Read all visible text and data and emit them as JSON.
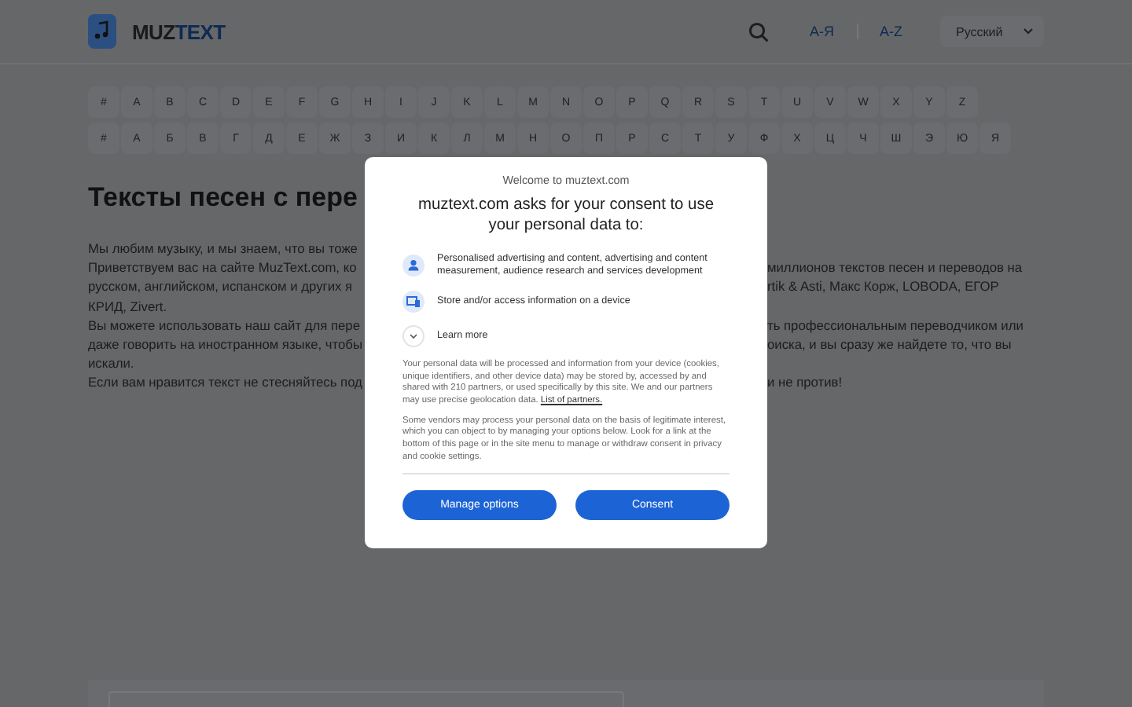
{
  "header": {
    "logo": [
      "MUZ",
      "TEXT"
    ],
    "alphabet_links": [
      {
        "label": "А-Я",
        "selected": false
      },
      {
        "label": "A-Z",
        "selected": false
      }
    ],
    "language": "Русский"
  },
  "latin_letters": [
    "#",
    "A",
    "B",
    "C",
    "D",
    "E",
    "F",
    "G",
    "H",
    "I",
    "J",
    "K",
    "L",
    "M",
    "N",
    "O",
    "P",
    "Q",
    "R",
    "S",
    "T",
    "U",
    "V",
    "W",
    "X",
    "Y",
    "Z"
  ],
  "cyrillic_letters": [
    "#",
    "А",
    "Б",
    "В",
    "Г",
    "Д",
    "Е",
    "Ж",
    "З",
    "И",
    "К",
    "Л",
    "М",
    "Н",
    "О",
    "П",
    "Р",
    "С",
    "Т",
    "У",
    "Ф",
    "Х",
    "Ц",
    "Ч",
    "Ш",
    "Э",
    "Ю",
    "Я"
  ],
  "heading": "Тексты песен с пере",
  "intro_lines": [
    {
      "left": "Мы любим музыку, и мы знаем, что вы тоже"
    },
    {
      "left": "Приветствуем вас на сайте MuzText.com, ко",
      "right": "миллионов текстов песен и переводов на"
    },
    {
      "left": "русском, английском, испанском и других я",
      "right": "rtik & Asti, Макс Корж, LOBODA, ЕГОР"
    },
    {
      "left": "КРИД, Zivert."
    },
    {
      "left": "Вы можете использовать наш сайт для пере",
      "right": "ть профессиональным переводчиком или"
    },
    {
      "left": "даже говорить на иностранном языке, чтобы",
      "right": "оиска, и вы сразу же найдете то, что вы"
    },
    {
      "left": "искали."
    },
    {
      "left": "Если вам нравится текст не стесняйтесь под",
      "right": "и не против!"
    }
  ],
  "consent_dialog": {
    "welcome": "Welcome to muztext.com",
    "title": "muztext.com asks for your consent to use your personal data to:",
    "purposes": [
      {
        "kind": "person",
        "text": "Personalised advertising and content, advertising and content measurement, audience research and services development"
      },
      {
        "kind": "device",
        "text": "Store and/or access information on a device"
      }
    ],
    "learn_more": {
      "label": "Learn more",
      "expanded": false
    },
    "paragraphs": [
      "Your personal data will be processed and information from your device (cookies, unique identifiers, and other device data) may be stored by, accessed by and shared with 210 partners, or used specifically by this site. We and our partners may use precise geolocation data.",
      "Some vendors may process your personal data on the basis of legitimate interest, which you can object to by managing your options below. Look for a link at the bottom of this page or in the site menu to manage or withdraw consent in privacy and cookie settings."
    ],
    "partners_link": "List of partners.",
    "buttons": [
      "Manage options",
      "Consent"
    ]
  }
}
